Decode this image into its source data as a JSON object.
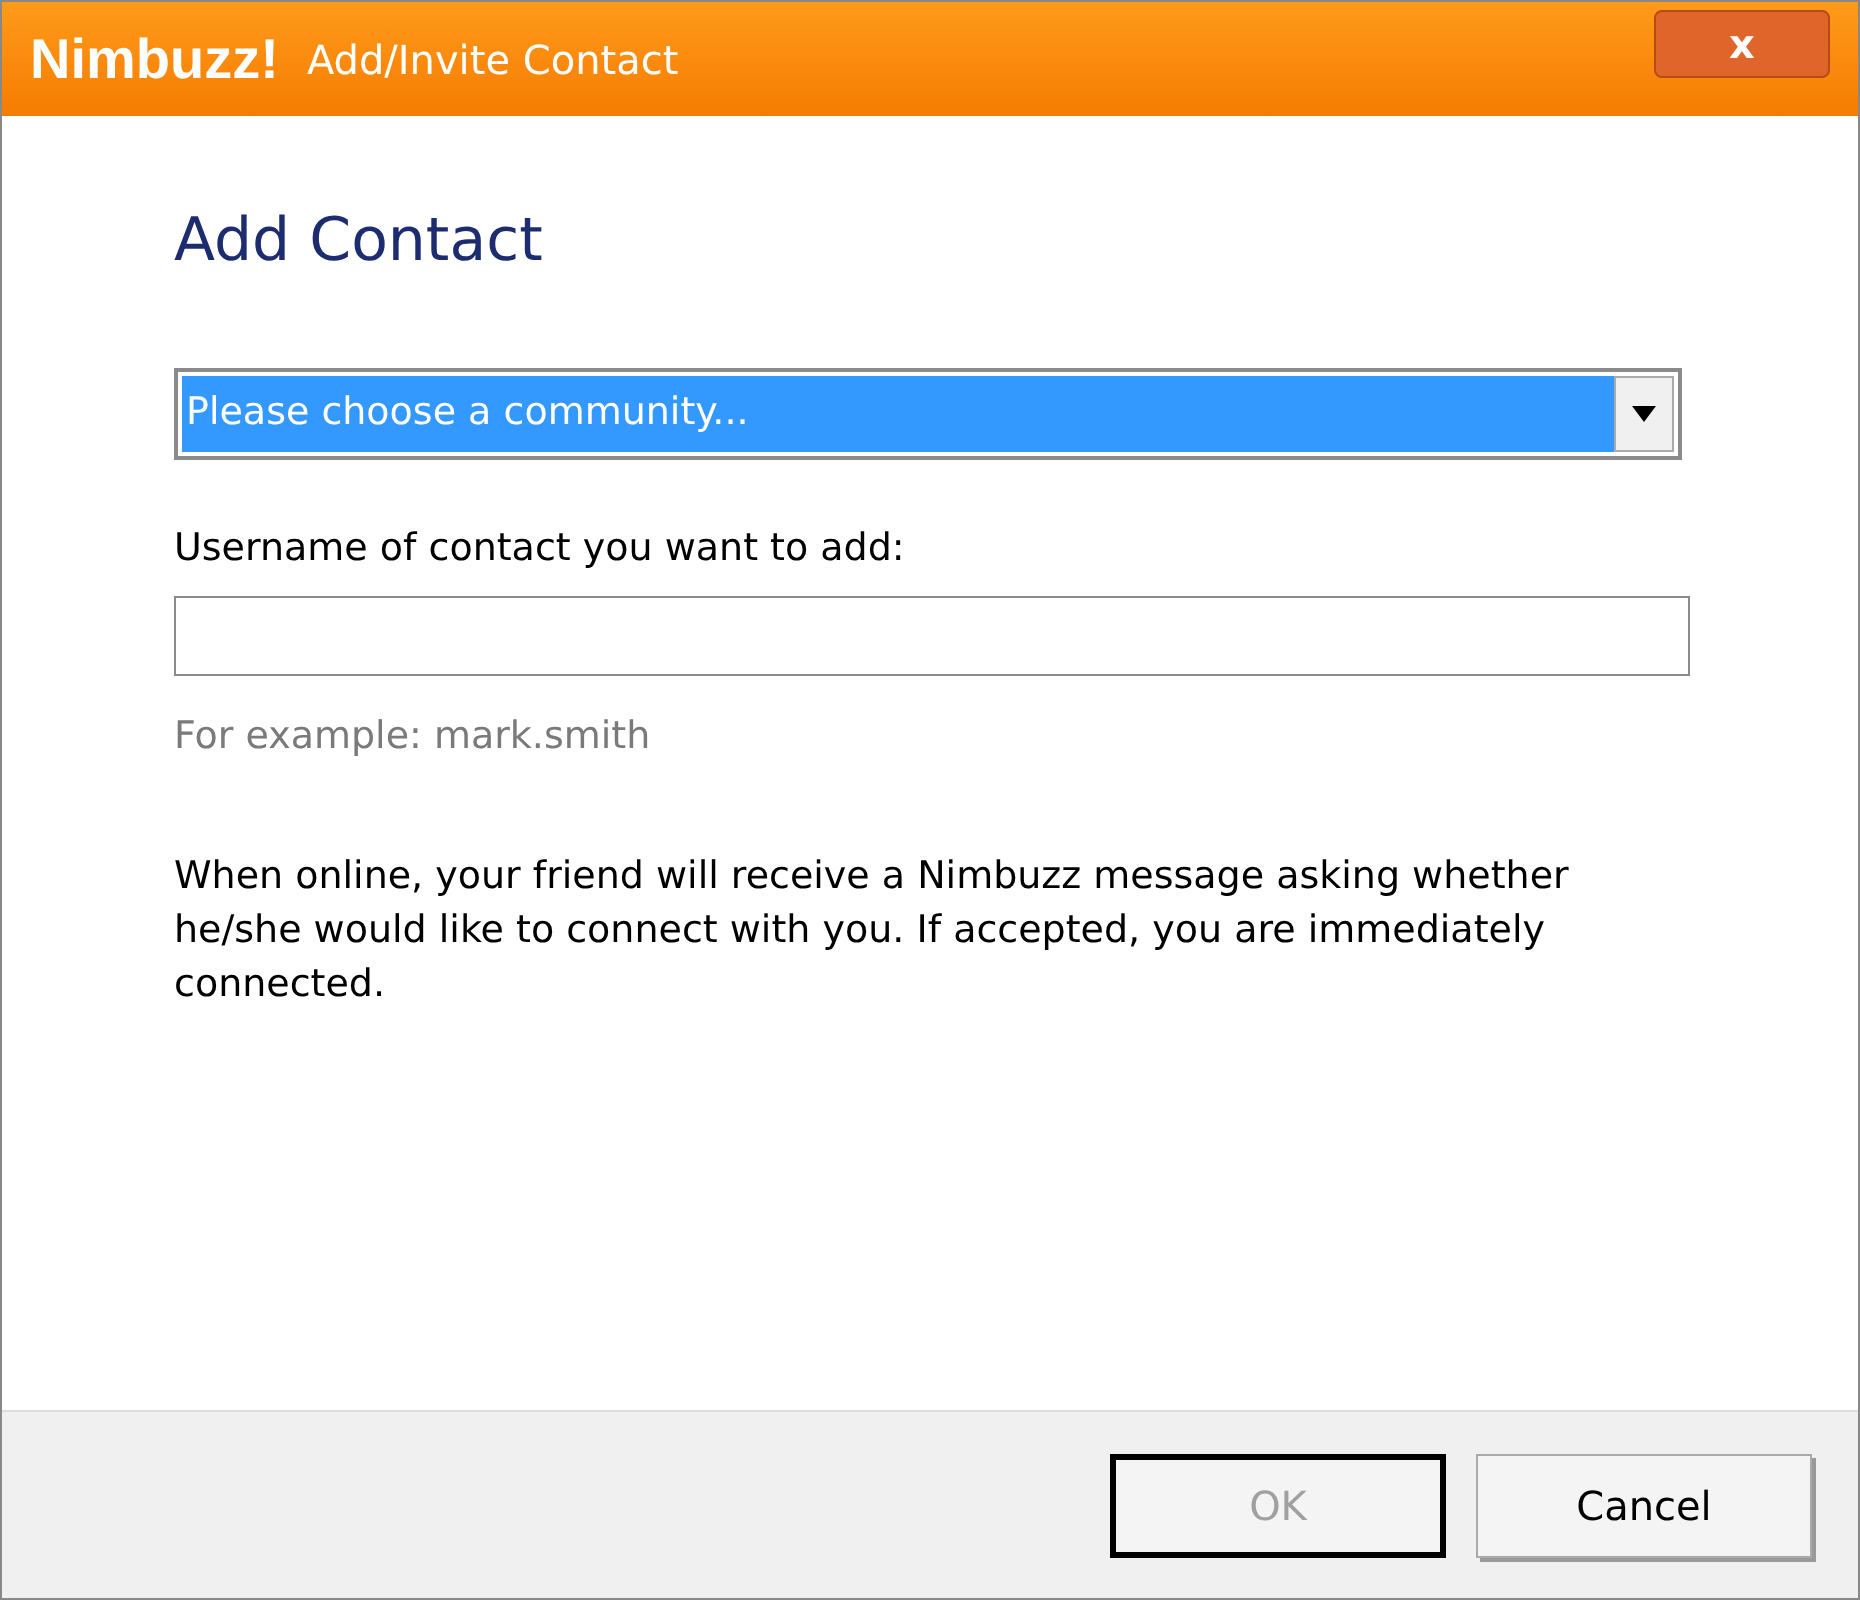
{
  "window": {
    "logo": "Nimbuzz!",
    "title": "Add/Invite Contact",
    "close": "x"
  },
  "heading": "Add Contact",
  "community_select": {
    "value": "Please choose a community...",
    "selected": true
  },
  "username": {
    "label": "Username of contact you want to add:",
    "hint": "For example: mark.smith"
  },
  "description": "When online, your friend will receive a Nimbuzz message asking whether he/she would like to connect with you. If accepted, you are immediately connected.",
  "buttons": [
    {
      "label": "OK",
      "disabled": true,
      "default": true
    },
    {
      "label": "Cancel",
      "disabled": false,
      "default": false
    }
  ]
}
